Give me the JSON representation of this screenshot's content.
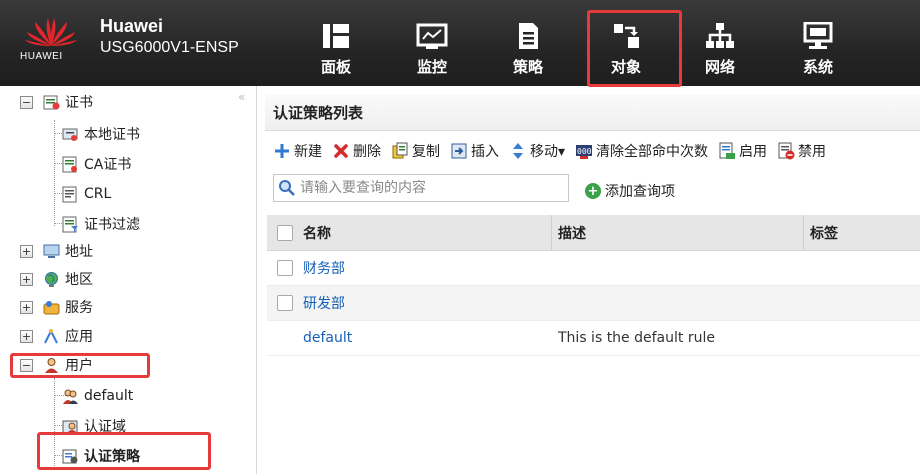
{
  "header": {
    "logo_text": "HUAWEI",
    "brand_line1": "Huawei",
    "brand_line2": "USG6000V1-ENSP",
    "nav": [
      {
        "label": "面板",
        "icon": "dashboard-icon"
      },
      {
        "label": "监控",
        "icon": "monitor-icon"
      },
      {
        "label": "策略",
        "icon": "policy-icon"
      },
      {
        "label": "对象",
        "icon": "object-icon",
        "active": true
      },
      {
        "label": "网络",
        "icon": "network-icon"
      },
      {
        "label": "系统",
        "icon": "system-icon"
      }
    ]
  },
  "sidebar": {
    "collapse_glyph": "«",
    "items": [
      {
        "label": "证书",
        "expander": "−",
        "icon": "certificate-icon"
      },
      {
        "label": "本地证书",
        "icon": "local-certificate-icon"
      },
      {
        "label": "CA证书",
        "icon": "ca-certificate-icon"
      },
      {
        "label": "CRL",
        "icon": "crl-icon"
      },
      {
        "label": "证书过滤",
        "icon": "certificate-filter-icon"
      },
      {
        "label": "地址",
        "expander": "+",
        "icon": "address-icon"
      },
      {
        "label": "地区",
        "expander": "+",
        "icon": "region-icon"
      },
      {
        "label": "服务",
        "expander": "+",
        "icon": "service-icon"
      },
      {
        "label": "应用",
        "expander": "+",
        "icon": "application-icon"
      },
      {
        "label": "用户",
        "expander": "−",
        "icon": "user-icon"
      },
      {
        "label": "default",
        "icon": "user-group-icon"
      },
      {
        "label": "认证域",
        "icon": "auth-domain-icon"
      },
      {
        "label": "认证策略",
        "icon": "auth-policy-icon",
        "active": true
      }
    ]
  },
  "main": {
    "title": "认证策略列表",
    "toolbar": [
      {
        "label": "新建",
        "icon": "add-icon"
      },
      {
        "label": "删除",
        "icon": "delete-icon"
      },
      {
        "label": "复制",
        "icon": "copy-icon"
      },
      {
        "label": "插入",
        "icon": "insert-icon"
      },
      {
        "label": "移动▾",
        "icon": "move-icon"
      },
      {
        "label": "清除全部命中次数",
        "icon": "clear-hits-icon"
      },
      {
        "label": "启用",
        "icon": "enable-icon"
      },
      {
        "label": "禁用",
        "icon": "disable-icon"
      }
    ],
    "search": {
      "placeholder": "请输入要查询的内容"
    },
    "add_query_label": "添加查询项",
    "columns": [
      "名称",
      "描述",
      "标签"
    ],
    "rows": [
      {
        "name": "财务部",
        "description": "",
        "tag": "",
        "checkbox": true
      },
      {
        "name": "研发部",
        "description": "",
        "tag": "",
        "checkbox": true
      },
      {
        "name": "default",
        "description": "This is the default rule",
        "tag": "",
        "checkbox": false
      }
    ]
  },
  "colors": {
    "header_bg": "#252525",
    "highlight_red": "#e53b3b",
    "link_blue": "#1560b8",
    "grid_header_bg": "#e6e6e6"
  }
}
